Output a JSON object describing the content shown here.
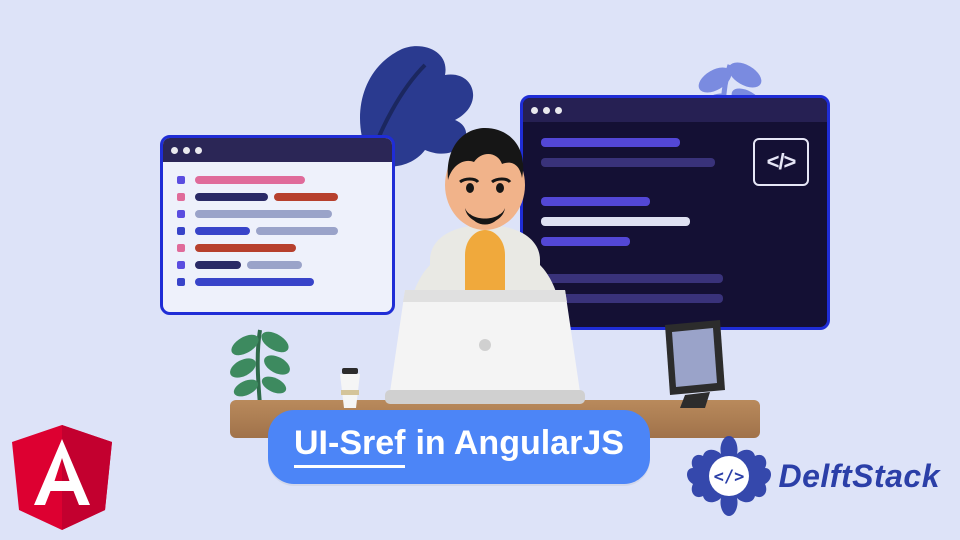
{
  "title": {
    "highlight": "UI-Sref",
    "rest": "in AngularJS"
  },
  "brand": {
    "name": "DelftStack"
  },
  "icons": {
    "code_tag": "</>",
    "angular_letter": "A"
  },
  "colors": {
    "bg": "#dde3f8",
    "pill": "#4c85f7",
    "angular": "#dd0031",
    "ds_blue": "#2b3fa8"
  }
}
